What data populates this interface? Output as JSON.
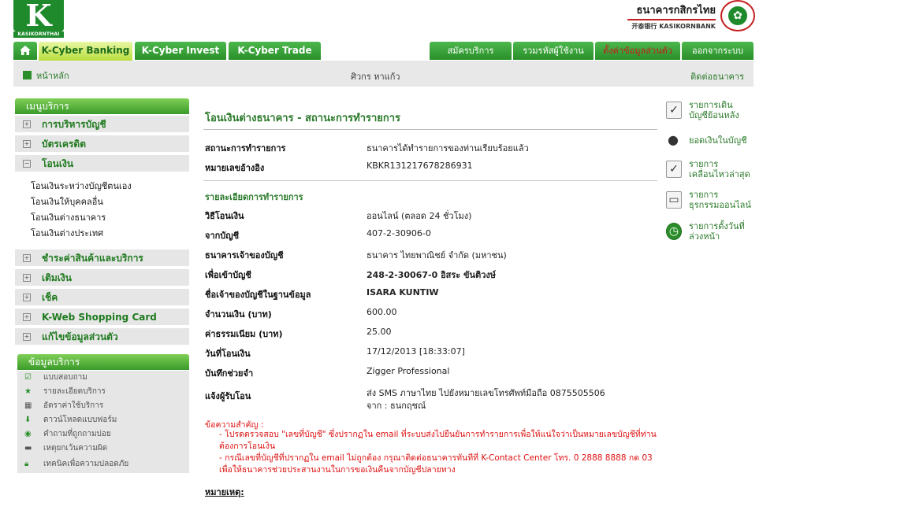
{
  "header": {
    "logo_letter": "K",
    "logo_text": "KASIKORNTHAI",
    "bank_thai": "ธนาคารกสิกรไทย",
    "bank_en": "开泰银行 KASIKORNBANK"
  },
  "tabs": [
    {
      "label": "K-Cyber Banking"
    },
    {
      "label": "K-Cyber Invest"
    },
    {
      "label": "K-Cyber Trade"
    },
    {
      "label": "สมัครบริการ"
    },
    {
      "label": "รวมรหัสผู้ใช้งาน"
    },
    {
      "label": "ตั้งค่าข้อมูลส่วนตัว"
    },
    {
      "label": "ออกจากระบบ"
    }
  ],
  "subbar": {
    "home": "หน้าหลัก",
    "user": "ศิวกร หาแก้ว",
    "contact": "ติดต่อธนาคาร"
  },
  "menu": {
    "title": "เมนูบริการ",
    "items": [
      {
        "label": "การบริหารบัญชี",
        "sign": "+"
      },
      {
        "label": "บัตรเครดิต",
        "sign": "+"
      },
      {
        "label": "โอนเงิน",
        "sign": "−"
      },
      {
        "label": "ชำระค่าสินค้าและบริการ",
        "sign": "+"
      },
      {
        "label": "เติมเงิน",
        "sign": "+"
      },
      {
        "label": "เช็ค",
        "sign": "+"
      },
      {
        "label": "K-Web Shopping Card",
        "sign": "+"
      },
      {
        "label": "แก้ไขข้อมูลส่วนตัว",
        "sign": "+"
      }
    ],
    "transfer_subitems": [
      "โอนเงินระหว่างบัญชีตนเอง",
      "โอนเงินให้บุคคลอื่น",
      "โอนเงินต่างธนาคาร",
      "โอนเงินต่างประเทศ"
    ]
  },
  "info": {
    "title": "ข้อมูลบริการ",
    "items": [
      "แบบสอบถาม",
      "รายละเอียดบริการ",
      "อัตราค่าใช้บริการ",
      "ดาวน์โหลดแบบฟอร์ม",
      "คำถามที่ถูกถามบ่อย",
      "เหตุยกเว้นความผิด",
      "เทคนิคเพื่อความปลอดภัย"
    ]
  },
  "main": {
    "title": "โอนเงินต่างธนาคาร - สถานะการทำรายการ",
    "status_label": "สถานะการทำรายการ",
    "status_value": "ธนาคารได้ทำรายการของท่านเรียบร้อยแล้ว",
    "ref_label": "หมายเลขอ้างอิง",
    "ref_value": "KBKR131217678286931",
    "section_title": "รายละเอียดการทำรายการ",
    "rows": [
      {
        "label": "วิธีโอนเงิน",
        "value": "ออนไลน์ (ตลอด 24 ชั่วโมง)"
      },
      {
        "label": "จากบัญชี",
        "value": "407-2-30906-0"
      },
      {
        "label": "ธนาคารเจ้าของบัญชี",
        "value": "ธนาคาร ไทยพาณิชย์ จำกัด (มหาชน)"
      },
      {
        "label": "เพื่อเข้าบัญชี",
        "value": "248-2-30067-0 อิสระ ขันติวงษ์"
      },
      {
        "label": "ชื่อเจ้าของบัญชีในฐานข้อมูล",
        "value": "ISARA KUNTIW"
      },
      {
        "label": "จำนวนเงิน (บาท)",
        "value": "600.00"
      },
      {
        "label": "ค่าธรรมเนียม (บาท)",
        "value": "25.00"
      },
      {
        "label": "วันที่โอนเงิน",
        "value": "17/12/2013 [18:33:07]"
      },
      {
        "label": "บันทึกช่วยจำ",
        "value": "Zigger Professional"
      },
      {
        "label": "แจ้งผู้รับโอน",
        "value": "ส่ง SMS ภาษาไทย ไปยังหมายเลขโทรศัพท์มือถือ 0875505506"
      }
    ],
    "notify_from": "จาก : ธนกฤชณ์",
    "note_title": "ข้อความสำคัญ :",
    "note_1": "- โปรดตรวจสอบ \"เลขที่บัญชี\" ซึ่งปรากฏใน email ที่ระบบส่งไปยืนยันการทำรายการเพื่อให้แน่ใจว่าเป็นหมายเลขบัญชีที่ท่านต้องการโอนเงิน",
    "note_2": "- กรณีเลขที่บัญชีที่ปรากฏใน email ไม่ถูกต้อง กรุณาติดต่อธนาคารทันทีที่ K-Contact Center โทร. 0 2888 8888 กด 03 เพื่อให้ธนาคารช่วยประสานงานในการขอเงินคืนจากบัญชีปลายทาง",
    "remark": "หมายเหตุ:"
  },
  "right_links": [
    {
      "line1": "รายการเดิน",
      "line2": "บัญชีย้อนหลัง",
      "icon": "document-check-icon"
    },
    {
      "line1": "ยอดเงินในบัญชี",
      "line2": "",
      "icon": "money-bag-icon"
    },
    {
      "line1": "รายการ",
      "line2": "เคลื่อนไหวล่าสุด",
      "icon": "document-check-icon"
    },
    {
      "line1": "รายการ",
      "line2": "ธุรกรรมออนไลน์",
      "icon": "monitor-icon"
    },
    {
      "line1": "รายการตั้งวันที่",
      "line2": "ล่วงหน้า",
      "icon": "clock-icon"
    }
  ]
}
